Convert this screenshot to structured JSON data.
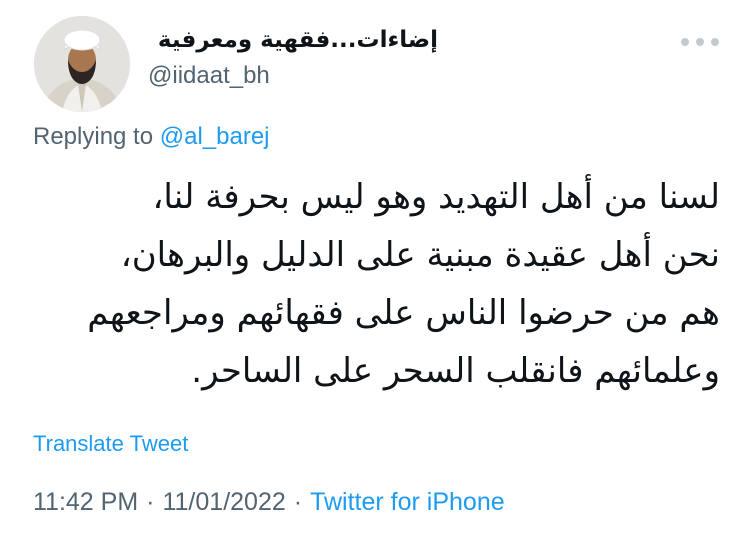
{
  "author": {
    "display_name": "إضاءات...فقهية ومعرفية",
    "handle": "@iidaat_bh"
  },
  "reply": {
    "prefix": "Replying to ",
    "mention": "@al_barej"
  },
  "tweet": {
    "lines": [
      "لسنا من أهل التهديد وهو ليس بحرفة لنا،",
      "نحن أهل عقيدة مبنية على الدليل والبرهان،",
      "هم من حرضوا الناس على فقهائهم ومراجعهم",
      "وعلمائهم فانقلب السحر على الساحر."
    ]
  },
  "translate_label": "Translate Tweet",
  "meta": {
    "time": "11:42 PM",
    "date": "11/01/2022",
    "separator": "·",
    "source": "Twitter for iPhone"
  },
  "icons": {
    "more": "more-horizontal-icon",
    "avatar": "profile-photo"
  },
  "colors": {
    "link_blue": "#1d9bf0",
    "secondary_text": "#536471",
    "primary_text": "#0f1419",
    "more_icon": "#c2cad0"
  }
}
